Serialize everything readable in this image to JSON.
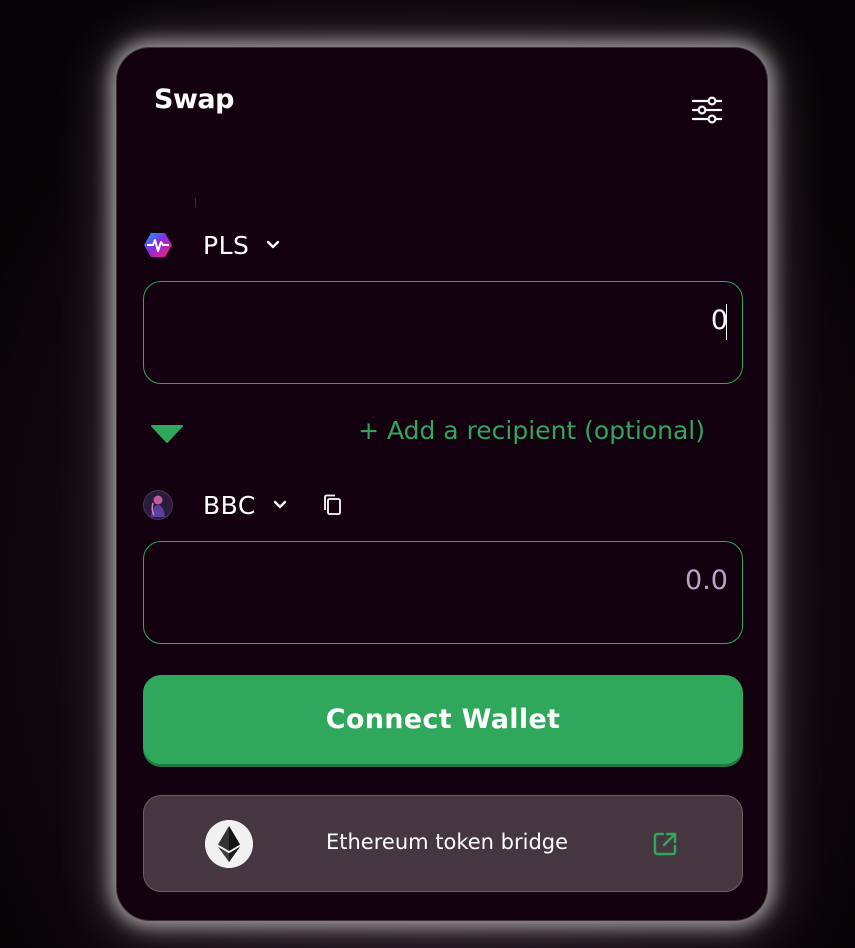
{
  "header": {
    "title": "Swap",
    "settings_icon": "sliders-icon"
  },
  "from_token": {
    "symbol": "PLS",
    "logo_icon": "pulsechain-logo",
    "amount": "0"
  },
  "recipient": {
    "toggle_icon": "triangle-down-icon",
    "add_label": "+ Add a recipient (optional)"
  },
  "to_token": {
    "symbol": "BBC",
    "logo_icon": "bbc-token-avatar",
    "copy_icon": "copy-icon",
    "amount_placeholder": "0.0"
  },
  "actions": {
    "connect_label": "Connect Wallet"
  },
  "bridge": {
    "label": "Ethereum token bridge",
    "logo_icon": "ethereum-logo",
    "link_icon": "external-link-icon"
  },
  "colors": {
    "accent_green": "#2fa85c",
    "card_bg": "#13010f",
    "bridge_bg": "#463640",
    "placeholder": "#b9a3c9"
  }
}
